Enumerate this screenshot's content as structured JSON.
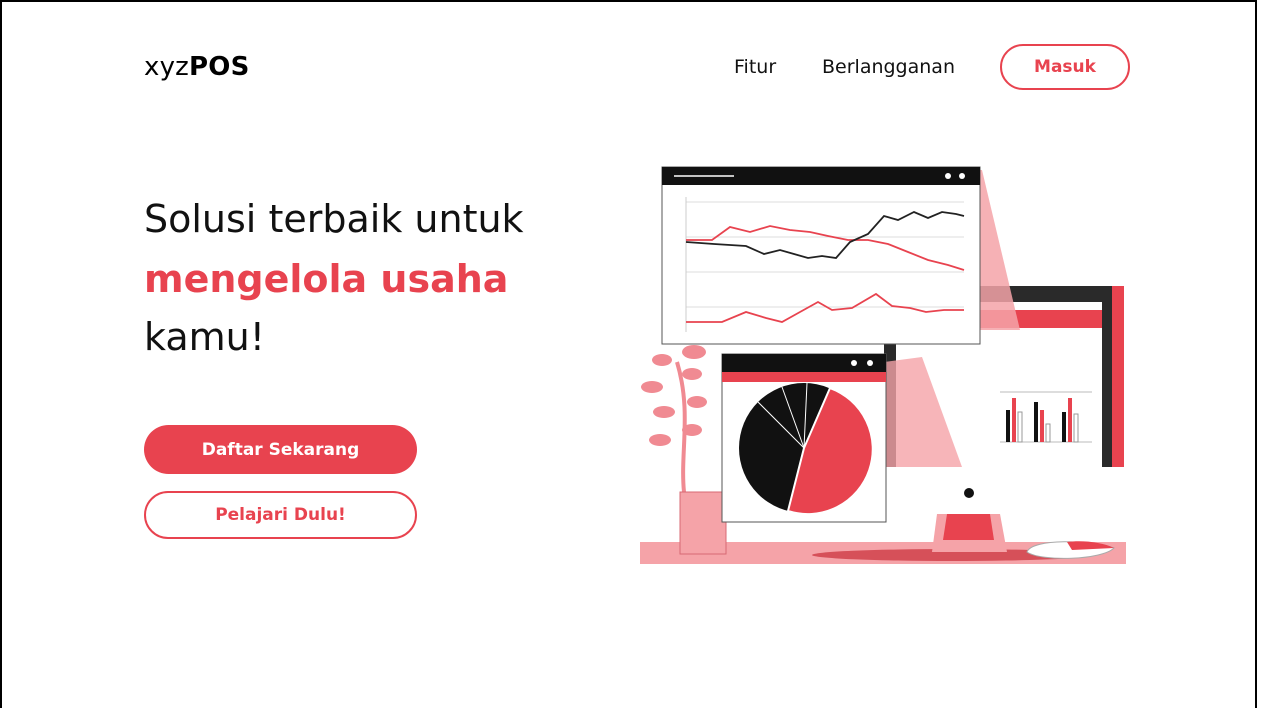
{
  "brand": {
    "prefix": "xyz",
    "bold": "POS"
  },
  "nav": {
    "items": [
      "Fitur",
      "Berlangganan"
    ],
    "login_label": "Masuk"
  },
  "hero": {
    "line1": "Solusi terbaik untuk",
    "line2": "mengelola usaha",
    "line3": "kamu!",
    "primary_cta": "Daftar Sekarang",
    "secondary_cta": "Pelajari Dulu!"
  },
  "illustration": {
    "name": "dashboard-analytics-illustration"
  },
  "colors": {
    "accent": "#e8434f",
    "accent_light": "#f5a3a8",
    "dark": "#111111",
    "background": "#ffffff"
  }
}
